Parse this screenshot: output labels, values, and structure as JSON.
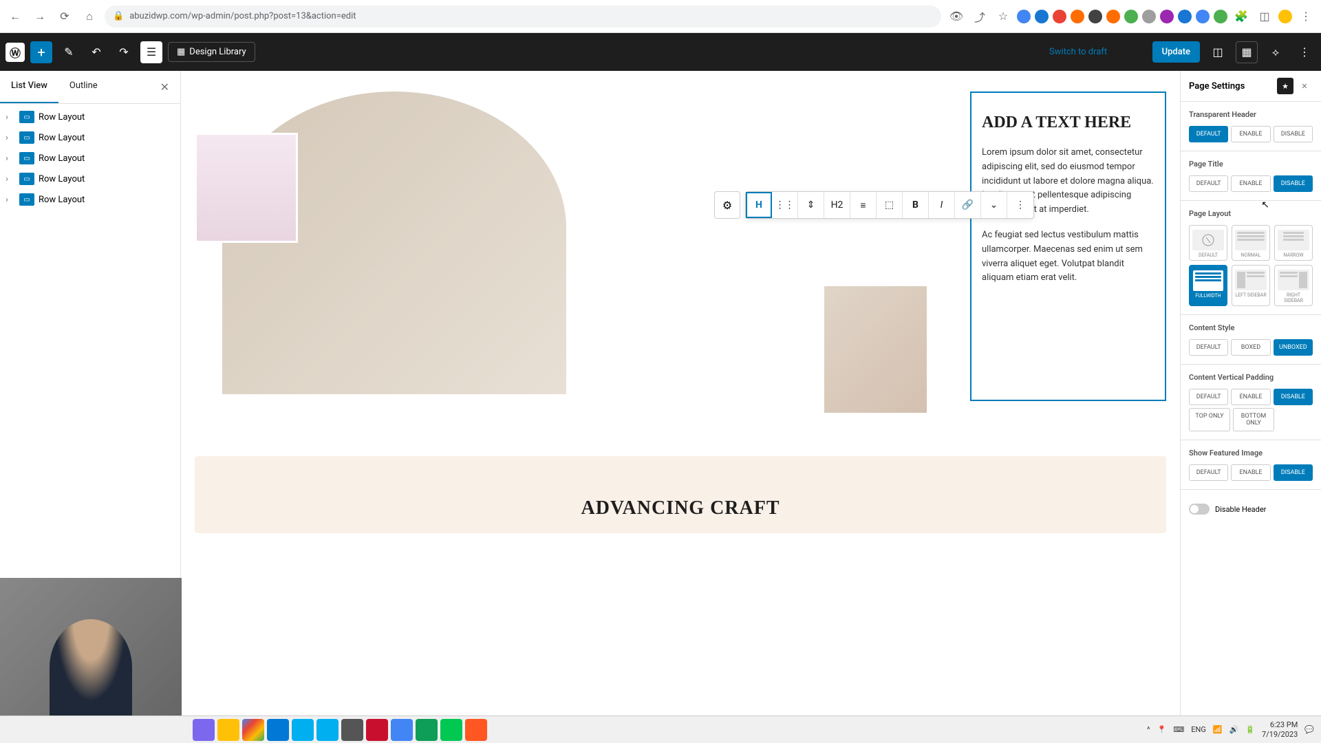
{
  "browser": {
    "url": "abuzidwp.com/wp-admin/post.php?post=13&action=edit"
  },
  "toolbar": {
    "design_library": "Design Library",
    "switch_draft": "Switch to draft",
    "preview": "Preview",
    "update": "Update"
  },
  "left_sidebar": {
    "tabs": {
      "list_view": "List View",
      "outline": "Outline"
    },
    "items": [
      {
        "label": "Row Layout"
      },
      {
        "label": "Row Layout"
      },
      {
        "label": "Row Layout"
      },
      {
        "label": "Row Layout"
      },
      {
        "label": "Row Layout"
      }
    ]
  },
  "block_toolbar": {
    "heading_level": "H2"
  },
  "content": {
    "heading": "ADD A TEXT HERE",
    "para1": "Lorem ipsum dolor sit amet, consectetur adipiscing elit, sed do eiusmod tempor incididunt ut labore et dolore magna aliqua. Iaculis at erat pellentesque adipiscing commodo elit at imperdiet.",
    "para2": "Ac feugiat sed lectus vestibulum mattis ullamcorper. Maecenas sed enim ut sem viverra aliquet eget. Volutpat blandit aliquam etiam erat velit.",
    "section2_heading": "ADVANCING CRAFT"
  },
  "right_sidebar": {
    "title": "Page Settings",
    "transparent_header": {
      "label": "Transparent Header",
      "options": [
        "DEFAULT",
        "ENABLE",
        "DISABLE"
      ],
      "active": 0
    },
    "page_title": {
      "label": "Page Title",
      "options": [
        "DEFAULT",
        "ENABLE",
        "DISABLE"
      ],
      "active": 2
    },
    "page_layout": {
      "label": "Page Layout",
      "options": [
        "DEFAULT",
        "NORMAL",
        "NARROW",
        "FULLWIDTH",
        "LEFT SIDEBAR",
        "RIGHT SIDEBAR"
      ],
      "active": 3
    },
    "content_style": {
      "label": "Content Style",
      "options": [
        "DEFAULT",
        "BOXED",
        "UNBOXED"
      ],
      "active": 2
    },
    "content_padding": {
      "label": "Content Vertical Padding",
      "options": [
        "DEFAULT",
        "ENABLE",
        "DISABLE",
        "TOP ONLY",
        "BOTTOM ONLY"
      ],
      "active": 2
    },
    "featured_image": {
      "label": "Show Featured Image",
      "options": [
        "DEFAULT",
        "ENABLE",
        "DISABLE"
      ],
      "active": 2
    },
    "disable_header": {
      "label": "Disable Header"
    }
  },
  "taskbar": {
    "lang": "ENG",
    "time": "6:23 PM",
    "date": "7/19/2023"
  }
}
